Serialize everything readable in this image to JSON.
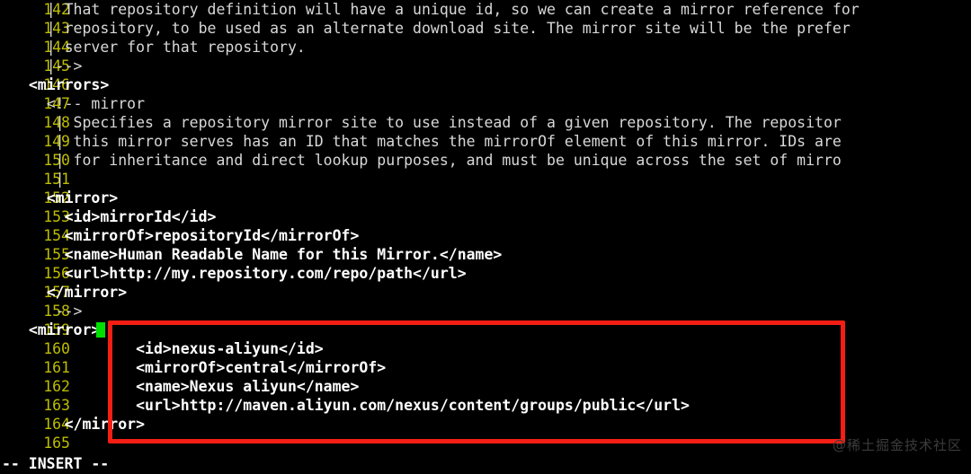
{
  "editor": {
    "mode_status": "-- INSERT --",
    "first_line_number": 142,
    "colors": {
      "background": "#000000",
      "line_number": "#bdbd00",
      "text": "#d8d8d8",
      "bold_text": "#ffffff",
      "cursor": "#00e000",
      "annotation_box": "#f41e14"
    },
    "lines": [
      {
        "n": "142",
        "text": "    | That repository definition will have a unique id, so we can create a mirror reference for",
        "bold": false
      },
      {
        "n": "143",
        "text": "    | repository, to be used as an alternate download site. The mirror site will be the prefer",
        "bold": false
      },
      {
        "n": "144",
        "text": "    | server for that repository.",
        "bold": false
      },
      {
        "n": "145",
        "text": "    |-->",
        "bold": false
      },
      {
        "n": "146",
        "text": "  <mirrors>",
        "bold": true
      },
      {
        "n": "147",
        "text": "    <!-- mirror",
        "bold": false
      },
      {
        "n": "148",
        "text": "     | Specifies a repository mirror site to use instead of a given repository. The repositor",
        "bold": false
      },
      {
        "n": "149",
        "text": "     | this mirror serves has an ID that matches the mirrorOf element of this mirror. IDs are",
        "bold": false
      },
      {
        "n": "150",
        "text": "     | for inheritance and direct lookup purposes, and must be unique across the set of mirro",
        "bold": false
      },
      {
        "n": "151",
        "text": "     |",
        "bold": false
      },
      {
        "n": "152",
        "text": "    <mirror>",
        "bold": true
      },
      {
        "n": "153",
        "text": "      <id>mirrorId</id>",
        "bold": true
      },
      {
        "n": "154",
        "text": "      <mirrorOf>repositoryId</mirrorOf>",
        "bold": true
      },
      {
        "n": "155",
        "text": "      <name>Human Readable Name for this Mirror.</name>",
        "bold": true
      },
      {
        "n": "156",
        "text": "      <url>http://my.repository.com/repo/path</url>",
        "bold": true
      },
      {
        "n": "157",
        "text": "    </mirror>",
        "bold": true
      },
      {
        "n": "158",
        "text": "     -->",
        "bold": false
      },
      {
        "n": "159",
        "text": "  <mirror>",
        "bold": true,
        "cursor_after": true
      },
      {
        "n": "160",
        "text": "              <id>nexus-aliyun</id>",
        "bold": true
      },
      {
        "n": "161",
        "text": "              <mirrorOf>central</mirrorOf>",
        "bold": true
      },
      {
        "n": "162",
        "text": "              <name>Nexus aliyun</name>",
        "bold": true
      },
      {
        "n": "163",
        "text": "              <url>http://maven.aliyun.com/nexus/content/groups/public</url>",
        "bold": true
      },
      {
        "n": "164",
        "text": "      </mirror>",
        "bold": true
      },
      {
        "n": "165",
        "text": "",
        "bold": false
      }
    ]
  },
  "annotation": {
    "box_label": "highlighted-mirror-block",
    "covers_lines": "159-164"
  },
  "watermark": {
    "text": "@稀土掘金技术社区"
  }
}
